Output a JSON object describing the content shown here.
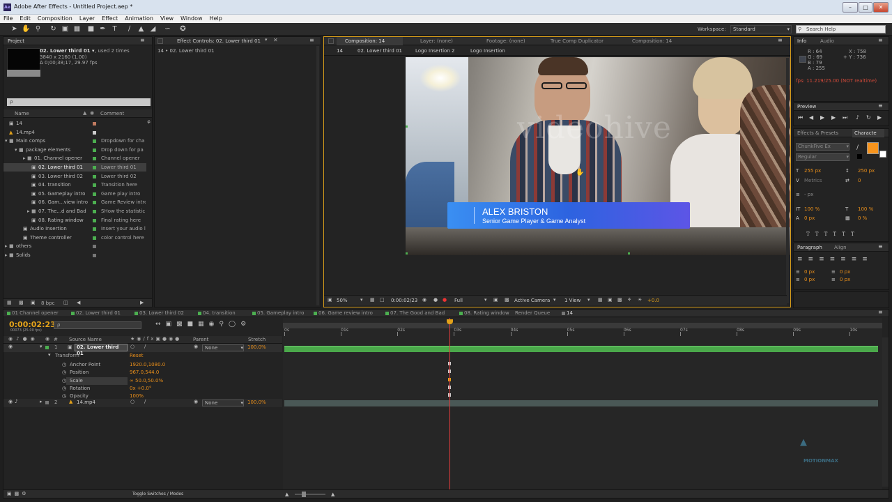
{
  "window": {
    "title": "Adobe After Effects - Untitled Project.aep *",
    "app_icon": "Ae"
  },
  "menu": [
    "File",
    "Edit",
    "Composition",
    "Layer",
    "Effect",
    "Animation",
    "View",
    "Window",
    "Help"
  ],
  "toolbar": {
    "workspace_label": "Workspace:",
    "workspace_value": "Standard",
    "search_placeholder": "Search Help"
  },
  "project": {
    "tab": "Project",
    "item_name": "02. Lower third 01 ▾",
    "item_used": ", used 2 times",
    "item_res": "3840 x 2160 (1.00)",
    "item_dur": "Δ 0;00;38;17, 29.97 fps",
    "search_placeholder": "ρ",
    "col_name": "Name",
    "col_comment": "Comment",
    "items": [
      {
        "name": "14",
        "comment": ""
      },
      {
        "name": "14.mp4",
        "comment": ""
      },
      {
        "name": "Main comps",
        "comment": "Dropdown for cha"
      },
      {
        "name": "package elements",
        "comment": "Drop down for pa"
      },
      {
        "name": "01. Channel opener",
        "comment": "Channel opener"
      },
      {
        "name": "02. Lower third 01",
        "comment": "Lower third 01"
      },
      {
        "name": "03. Lower third 02",
        "comment": "Lower third 02"
      },
      {
        "name": "04. transition",
        "comment": "Transition here"
      },
      {
        "name": "05. Gameplay intro",
        "comment": "Game play intro"
      },
      {
        "name": "06. Gam...view intro",
        "comment": "Game Review intro"
      },
      {
        "name": "07. The...d and Bad",
        "comment": "SHow the statistic"
      },
      {
        "name": "08. Rating window",
        "comment": "Final rating here"
      },
      {
        "name": "Audio Insertion",
        "comment": "Insert your audio l"
      },
      {
        "name": "Theme controller",
        "comment": "color control here"
      },
      {
        "name": "others",
        "comment": ""
      },
      {
        "name": "Solids",
        "comment": ""
      }
    ],
    "bpc": "8 bpc"
  },
  "effect_controls": {
    "tab": "Effect Controls: 02. Lower third 01",
    "breadcrumb": "14 • 02. Lower third 01"
  },
  "composition": {
    "tabs": [
      "Composition: 14",
      "Layer: (none)",
      "Footage: (none)",
      "True Comp Duplicator",
      "Composition: 14"
    ],
    "subtabs": [
      "14",
      "02. Lower third 01",
      "Logo Insertion 2",
      "Logo Insertion"
    ],
    "lower_third_name": "ALEX BRISTON",
    "lower_third_title": "Senior Game Player & Game Analyst",
    "watermark": "videohive",
    "zoom": "50%",
    "time": "0:00:02/23",
    "resolution": "Full",
    "camera": "Active Camera",
    "views": "1 View",
    "exposure": "+0.0"
  },
  "info": {
    "tab": "Info",
    "tab2": "Audio",
    "r": "R : 64",
    "g": "G : 69",
    "b": "B : 79",
    "a": "A : 255",
    "x": "X : 758",
    "y": "+ Y : 736",
    "fps": "fps: 11.219/25.00 (NOT realtime)"
  },
  "preview": {
    "tab": "Preview"
  },
  "effects_presets": {
    "tab": "Effects & Presets",
    "tab2": "Characte"
  },
  "character": {
    "font": "ChunkFive Ex",
    "style": "Regular",
    "size": "255 px",
    "leading": "250 px",
    "kerning": "Metrics",
    "tracking": "0",
    "stroke": "- px",
    "vscale": "100 %",
    "hscale": "100 %",
    "baseline": "0 px",
    "tsume": "0 %",
    "accent": "#f7941d"
  },
  "paragraph": {
    "tab": "Paragraph",
    "tab2": "Align",
    "l1": "0 px",
    "l2": "0 px",
    "l3": "0 px",
    "r1": "0 px",
    "r2": "0 px"
  },
  "timeline": {
    "tabs": [
      "01 Channel opener",
      "02. Lower third 01",
      "03. Lower third 02",
      "04. transition",
      "05. Gameplay intro",
      "06. Game review intro",
      "07. The Good and Bad",
      "08. Rating window",
      "Render Queue",
      "14"
    ],
    "timecode": "0:00:02:23",
    "frame": "00073 (25.00 fps)",
    "col_source": "Source Name",
    "col_parent": "Parent",
    "col_stretch": "Stretch",
    "layer1": {
      "num": "1",
      "name": "02. Lower third 01",
      "parent": "None",
      "stretch": "100.0%"
    },
    "transform": "Transform",
    "reset": "Reset",
    "props": [
      {
        "name": "Anchor Point",
        "value": "1920.0,1080.0"
      },
      {
        "name": "Position",
        "value": "967.0,544.0"
      },
      {
        "name": "Scale",
        "value": "∞ 50.0,50.0%"
      },
      {
        "name": "Rotation",
        "value": "0x +0.0°"
      },
      {
        "name": "Opacity",
        "value": "100%"
      }
    ],
    "layer2": {
      "num": "2",
      "name": "14.mp4",
      "parent": "None",
      "stretch": "100.0%"
    },
    "ruler": [
      "0s",
      "01s",
      "02s",
      "03s",
      "04s",
      "05s",
      "06s",
      "07s",
      "08s",
      "09s",
      "10s"
    ],
    "playhead_seconds": 2.92,
    "duration_seconds": 10.5,
    "toggle": "Toggle Switches / Modes"
  },
  "watermark2": "MOTIONMAX"
}
